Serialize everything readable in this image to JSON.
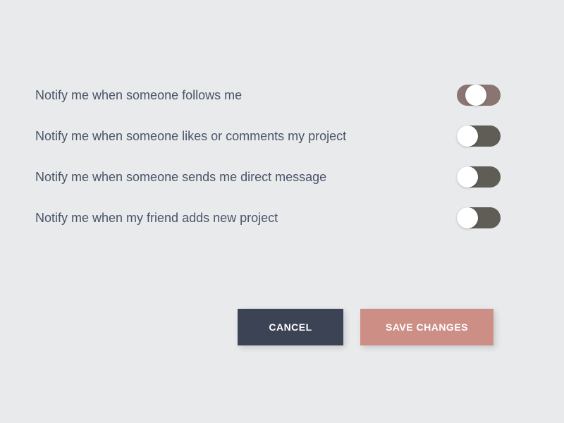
{
  "settings": [
    {
      "label": "Notify me when someone follows me",
      "state": "on"
    },
    {
      "label": "Notify me when someone likes or comments my project",
      "state": "off"
    },
    {
      "label": "Notify me when someone sends me direct message",
      "state": "off"
    },
    {
      "label": "Notify me when my friend adds new project",
      "state": "off"
    }
  ],
  "buttons": {
    "cancel": "CANCEL",
    "save": "SAVE CHANGES"
  },
  "colors": {
    "background": "#e8eaec",
    "text": "#4a5568",
    "toggle_off": "#5f5d56",
    "toggle_on": "#8a7572",
    "cancel_btn": "#3b4354",
    "save_btn": "#cd8e85"
  }
}
